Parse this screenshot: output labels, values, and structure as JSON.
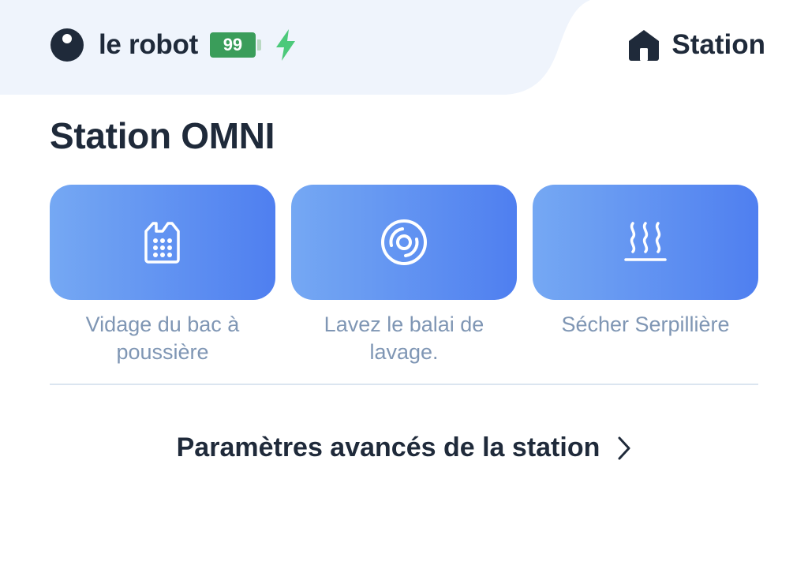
{
  "tabs": {
    "robot": {
      "name": "le robot",
      "battery_level": "99",
      "charging": true
    },
    "station": {
      "label": "Station",
      "active": true
    }
  },
  "section": {
    "title": "Station OMNI"
  },
  "actions": [
    {
      "icon": "dust-bin-icon",
      "label": "Vidage du bac à poussière"
    },
    {
      "icon": "mop-wash-icon",
      "label": "Lavez le balai de lavage."
    },
    {
      "icon": "heat-dry-icon",
      "label": "Sécher Serpillière"
    }
  ],
  "advanced": {
    "label": "Paramètres avancés de la station"
  },
  "colors": {
    "text_primary": "#1f2a3a",
    "text_secondary": "#7f96b4",
    "button_gradient_start": "#75a8f3",
    "button_gradient_end": "#4f7ff0",
    "battery_green": "#3a9d5a",
    "charging_green": "#4cc97a",
    "inactive_tab_bg": "#eff4fc"
  }
}
